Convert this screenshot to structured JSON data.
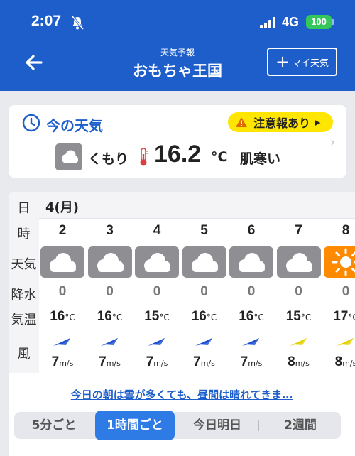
{
  "status_bar": {
    "time": "2:07",
    "network": "4G",
    "battery": "100"
  },
  "header": {
    "subtitle": "天気予報",
    "title": "おもちゃ王国",
    "my_weather_label": "マイ天気"
  },
  "current": {
    "label": "今の天気",
    "warning": "注意報あり",
    "condition": "くもり",
    "temperature": "16.2",
    "unit": "°C",
    "feel": "肌寒い"
  },
  "hourly": {
    "row_labels": {
      "day": "日",
      "hour": "時",
      "weather": "天気",
      "precip": "降水",
      "temp": "気温",
      "wind": "風"
    },
    "day": "4(月)",
    "temp_unit": "°C",
    "wind_unit": "m/s",
    "hours": [
      {
        "hour": "2",
        "weather": "cloudy-icon",
        "precip": "0",
        "temp": "16",
        "wind": "7",
        "wind_color": "#1a4fd1"
      },
      {
        "hour": "3",
        "weather": "cloudy-icon",
        "precip": "0",
        "temp": "16",
        "wind": "7",
        "wind_color": "#1a4fd1"
      },
      {
        "hour": "4",
        "weather": "cloudy-icon",
        "precip": "0",
        "temp": "15",
        "wind": "7",
        "wind_color": "#1a4fd1"
      },
      {
        "hour": "5",
        "weather": "cloudy-icon",
        "precip": "0",
        "temp": "16",
        "wind": "7",
        "wind_color": "#1a4fd1"
      },
      {
        "hour": "6",
        "weather": "cloudy-icon",
        "precip": "0",
        "temp": "16",
        "wind": "7",
        "wind_color": "#1a4fd1"
      },
      {
        "hour": "7",
        "weather": "cloudy-icon",
        "precip": "0",
        "temp": "15",
        "wind": "8",
        "wind_color": "#e5d000"
      },
      {
        "hour": "8",
        "weather": "sunny-icon",
        "precip": "0",
        "temp": "17",
        "wind": "8",
        "wind_color": "#e5d000"
      }
    ],
    "summary": "今日の朝は雲が多くても、昼間は晴れてきま…"
  },
  "tabs": [
    {
      "label": "5分ごと",
      "active": false
    },
    {
      "label": "1時間ごと",
      "active": true
    },
    {
      "label": "今日明日",
      "active": false
    },
    {
      "label": "2週間",
      "active": false
    }
  ],
  "colors": {
    "brand": "#1d5ecb",
    "warning": "#ffe600",
    "tab_active": "#2e7be6",
    "sunny": "#ff8a00",
    "cloudy": "#8e8e93"
  }
}
